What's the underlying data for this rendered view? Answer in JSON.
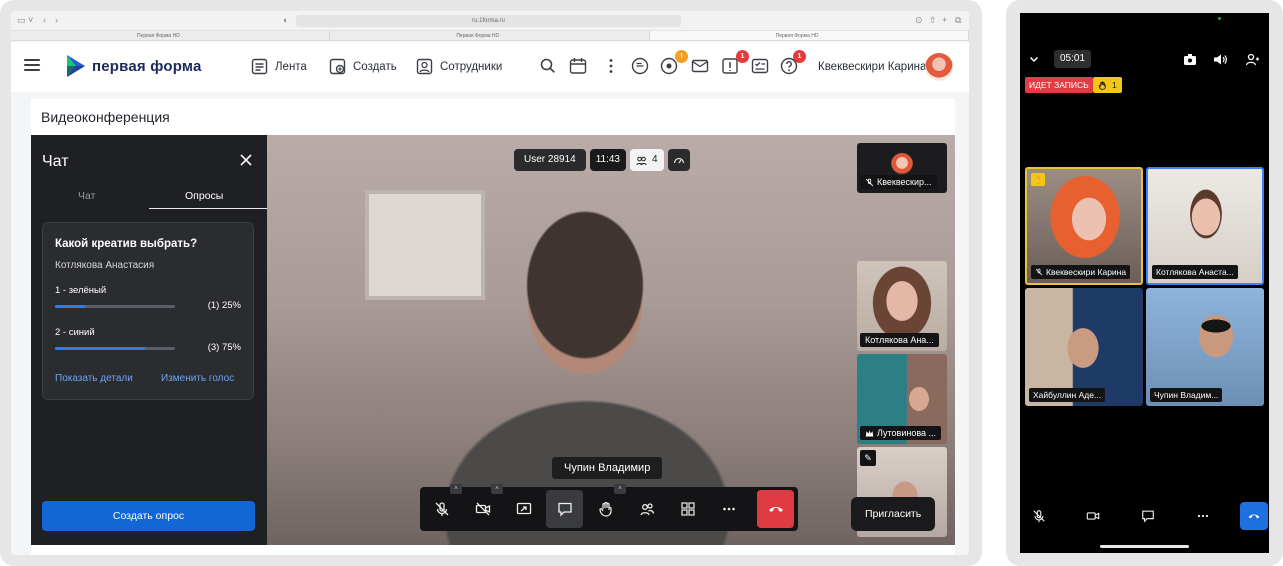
{
  "browser": {
    "url": "ru.1forma.ru",
    "tabs": [
      "Первая Форма HD",
      "Первая Форма HD",
      "Первая Форма HD"
    ]
  },
  "header": {
    "brand": "первая форма",
    "nav": [
      "Лента",
      "Создать",
      "Сотрудники"
    ],
    "badges": {
      "notifications": "1",
      "tasks": "1",
      "help": "1"
    },
    "user_name": "Квеквескири Карина"
  },
  "page": {
    "title": "Видеоконференция"
  },
  "chat": {
    "title": "Чат",
    "tabs": [
      "Чат",
      "Опросы"
    ],
    "poll": {
      "question": "Какой креатив выбрать?",
      "author": "Котлякова Анастасия",
      "options": [
        {
          "label": "1 - зелёный",
          "value": "(1) 25%",
          "fraction": 0.25
        },
        {
          "label": "2 - синий",
          "value": "(3) 75%",
          "fraction": 0.75
        }
      ],
      "details_link": "Показать детали",
      "change_link": "Изменить голос"
    },
    "create_button": "Создать опрос"
  },
  "conference": {
    "user_pill": "User 28914",
    "time": "11:43",
    "participants": "4",
    "speaker": "Чупин Владимир",
    "invite": "Пригласить",
    "thumbnails": [
      "Квеквескир...",
      "Котлякова Ана...",
      "Лутовинова ..."
    ]
  },
  "phone": {
    "time": "05:01",
    "recording": "ИДЕТ ЗАПИСЬ",
    "raised_hands": "1",
    "tiles": [
      "Квеквескири Карина",
      "Котлякова Анаста...",
      "Хайбуллин Аде...",
      "Чупин Владим..."
    ]
  },
  "colors": {
    "accent": "#1366d6",
    "end_call": "#e03a42",
    "recording": "#e23c44",
    "raised_hand": "#f3c716"
  }
}
